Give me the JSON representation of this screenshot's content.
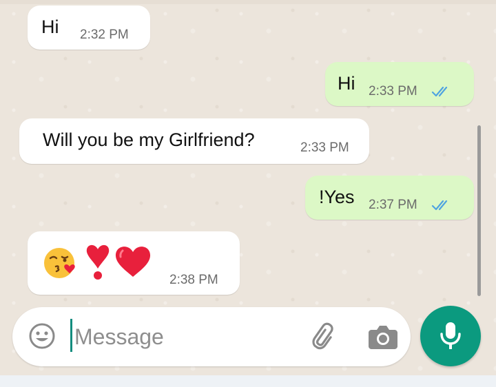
{
  "messages": [
    {
      "direction": "incoming",
      "text": "Hi",
      "time": "2:32 PM"
    },
    {
      "direction": "outgoing",
      "text": "Hi",
      "time": "2:33 PM",
      "status": "read"
    },
    {
      "direction": "incoming",
      "text": "Will you be my Girlfriend?",
      "time": "2:33 PM"
    },
    {
      "direction": "outgoing",
      "text": "!Yes",
      "time": "2:37 PM",
      "status": "read"
    },
    {
      "direction": "incoming",
      "text": "",
      "emojis": [
        "kissing-face-with-heart-emoji",
        "heart-exclamation-emoji",
        "red-heart-emoji"
      ],
      "time": "2:38 PM"
    }
  ],
  "composer": {
    "placeholder": "Message",
    "icons": [
      "emoji-icon",
      "paperclip-icon",
      "camera-icon",
      "microphone-icon"
    ]
  },
  "colors": {
    "incoming_bubble": "#ffffff",
    "outgoing_bubble": "#dcf8c6",
    "read_ticks": "#4fa3e0",
    "mic_button": "#0b9a7f",
    "chat_background": "#ece5dc"
  }
}
